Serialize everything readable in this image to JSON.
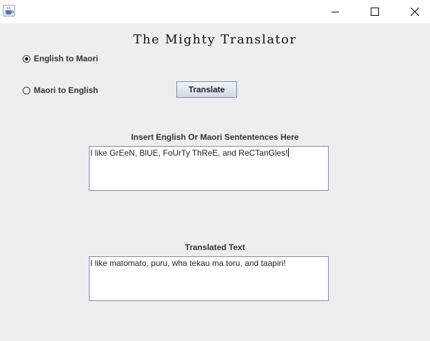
{
  "window": {
    "controls": {
      "minimize": "minimize-icon",
      "maximize": "maximize-icon",
      "close": "close-icon"
    },
    "app_icon": "java-cup-icon"
  },
  "app": {
    "title": "The Mighty Translator"
  },
  "direction": {
    "options": [
      "English to Maori",
      "Maori to English"
    ],
    "selected": "English to Maori"
  },
  "actions": {
    "translate_label": "Translate"
  },
  "input": {
    "label": "Insert English Or Maori Sententences Here",
    "value": "I like GrEeN, BlUE, FoUrTy ThReE, and ReCTanGles!"
  },
  "output": {
    "label": "Translated Text",
    "value": "I like matomato, puru, wha tekau ma toru, and taapiri!"
  }
}
